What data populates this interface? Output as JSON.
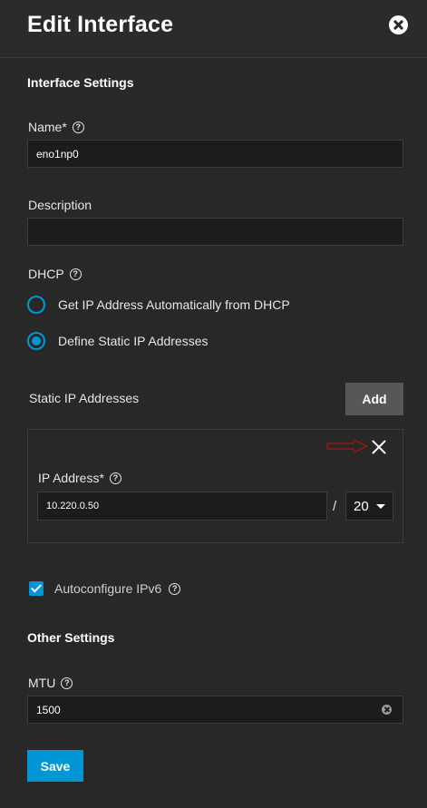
{
  "dialog": {
    "title": "Edit Interface",
    "close_icon": "close-circle-icon"
  },
  "interface_settings": {
    "heading": "Interface Settings",
    "name": {
      "label": "Name*",
      "value": "eno1np0",
      "help_icon": "help-icon"
    },
    "description": {
      "label": "Description",
      "value": ""
    },
    "dhcp": {
      "label": "DHCP",
      "help_icon": "help-icon",
      "options": [
        {
          "label": "Get IP Address Automatically from DHCP",
          "checked": false
        },
        {
          "label": "Define Static IP Addresses",
          "checked": true
        }
      ]
    }
  },
  "static_ip": {
    "heading": "Static IP Addresses",
    "add_label": "Add",
    "remove_icon": "close-icon",
    "ip_address": {
      "label": "IP Address*",
      "value": "10.220.0.50",
      "help_icon": "help-icon"
    },
    "separator": "/",
    "netmask": {
      "value": "20"
    }
  },
  "autoconfigure_ipv6": {
    "label": "Autoconfigure IPv6",
    "checked": true
  },
  "other_settings": {
    "heading": "Other Settings",
    "mtu": {
      "label": "MTU",
      "value": "1500"
    }
  },
  "actions": {
    "save_label": "Save"
  },
  "colors": {
    "accent": "#0095d5",
    "background": "#282828",
    "input_bg": "#1c1c1c",
    "annotation_arrow": "#8b1a1a"
  }
}
